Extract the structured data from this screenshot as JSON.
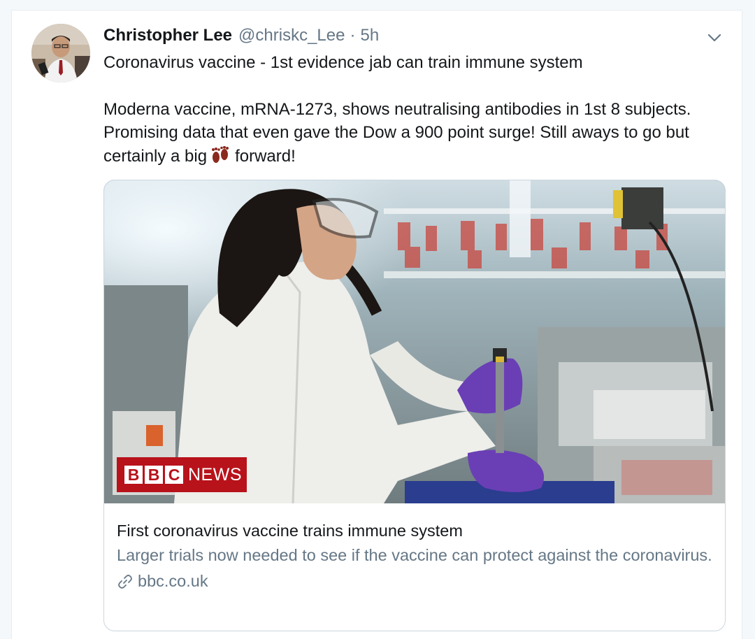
{
  "tweet": {
    "author_name": "Christopher Lee",
    "handle": "@chriskc_Lee",
    "separator": "·",
    "time": "5h",
    "headline": "Coronavirus vaccine - 1st evidence jab can train immune system",
    "body_part1": "Moderna vaccine, mRNA-1273, shows neutralising antibodies in 1st 8 subjects. Promising data that even gave the Dow a 900 point surge! Still aways to go but certainly a big",
    "emoji_icon": "footprints-icon",
    "body_part2": "forward!"
  },
  "card": {
    "image_description_icon": "lab-scientist-photo",
    "logo": {
      "letters": [
        "B",
        "B",
        "C"
      ],
      "word": "NEWS"
    },
    "title": "First coronavirus vaccine trains immune system",
    "description": "Larger trials now needed to see if the vaccine can protect against the coronavirus.",
    "domain": "bbc.co.uk"
  },
  "colors": {
    "text_primary": "#14171a",
    "text_secondary": "#657786",
    "border": "#ccd6dd",
    "bbc_red": "#b8121b",
    "glove_purple": "#6a3fb5"
  }
}
